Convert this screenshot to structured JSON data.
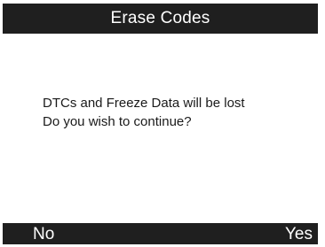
{
  "header": {
    "title": "Erase Codes"
  },
  "dialog": {
    "line1": "DTCs and Freeze Data will be lost",
    "line2": "Do you wish to continue?"
  },
  "footer": {
    "no_label": "No",
    "yes_label": "Yes"
  },
  "colors": {
    "bar_background": "#1f1f1f",
    "bar_text": "#ffffff",
    "content_background": "#ffffff",
    "content_text": "#1a1a1a"
  }
}
